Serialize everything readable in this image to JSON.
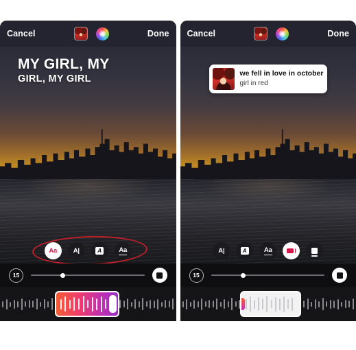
{
  "header": {
    "cancel_label": "Cancel",
    "done_label": "Done",
    "album_thumb_icon": "album-art-icon",
    "color_wheel_icon": "color-wheel-icon"
  },
  "left_panel": {
    "name": "text-style-panel",
    "lyric": {
      "line1": "MY GIRL, MY",
      "line2": "GIRL, MY GIRL"
    },
    "style_buttons": [
      {
        "glyph": "Aa",
        "kind": "plain",
        "name": "style-aa-filled",
        "selected": true
      },
      {
        "glyph": "A|",
        "kind": "plain",
        "name": "style-a-bar",
        "selected": false
      },
      {
        "glyph": "A",
        "kind": "boxed",
        "name": "style-a-boxed",
        "selected": false
      },
      {
        "glyph": "Aa",
        "kind": "underline",
        "name": "style-aa-underline",
        "selected": false
      }
    ],
    "annotation": "red-ellipse-highlight",
    "controls": {
      "duration": "15",
      "slider_name": "scrub-slider",
      "record_name": "stop-record-button"
    },
    "timeline": {
      "selection_style": "gradient",
      "selection_name": "waveform-selection"
    }
  },
  "right_panel": {
    "name": "music-sticker-panel",
    "music_card": {
      "title": "we fell in love in october",
      "artist": "girl in red",
      "art_icon": "album-art-icon"
    },
    "style_buttons": [
      {
        "glyph": "A|",
        "kind": "plain",
        "name": "style-a-bar",
        "selected": false
      },
      {
        "glyph": "A",
        "kind": "boxed",
        "name": "style-a-boxed",
        "selected": false
      },
      {
        "glyph": "Aa",
        "kind": "underline",
        "name": "style-aa-underline",
        "selected": false
      },
      {
        "glyph": "",
        "kind": "rect",
        "name": "style-card-filled",
        "selected": true
      },
      {
        "glyph": "",
        "kind": "card",
        "name": "style-card-outline",
        "selected": false
      }
    ],
    "controls": {
      "duration": "15",
      "slider_name": "scrub-slider",
      "record_name": "stop-record-button"
    },
    "timeline": {
      "selection_style": "plain",
      "selection_name": "waveform-selection"
    }
  },
  "colors": {
    "accent_red": "#d6164b",
    "annotation_red": "#c0202a",
    "panel_bg": "#0e0e10",
    "topbar_bg": "#232430"
  }
}
